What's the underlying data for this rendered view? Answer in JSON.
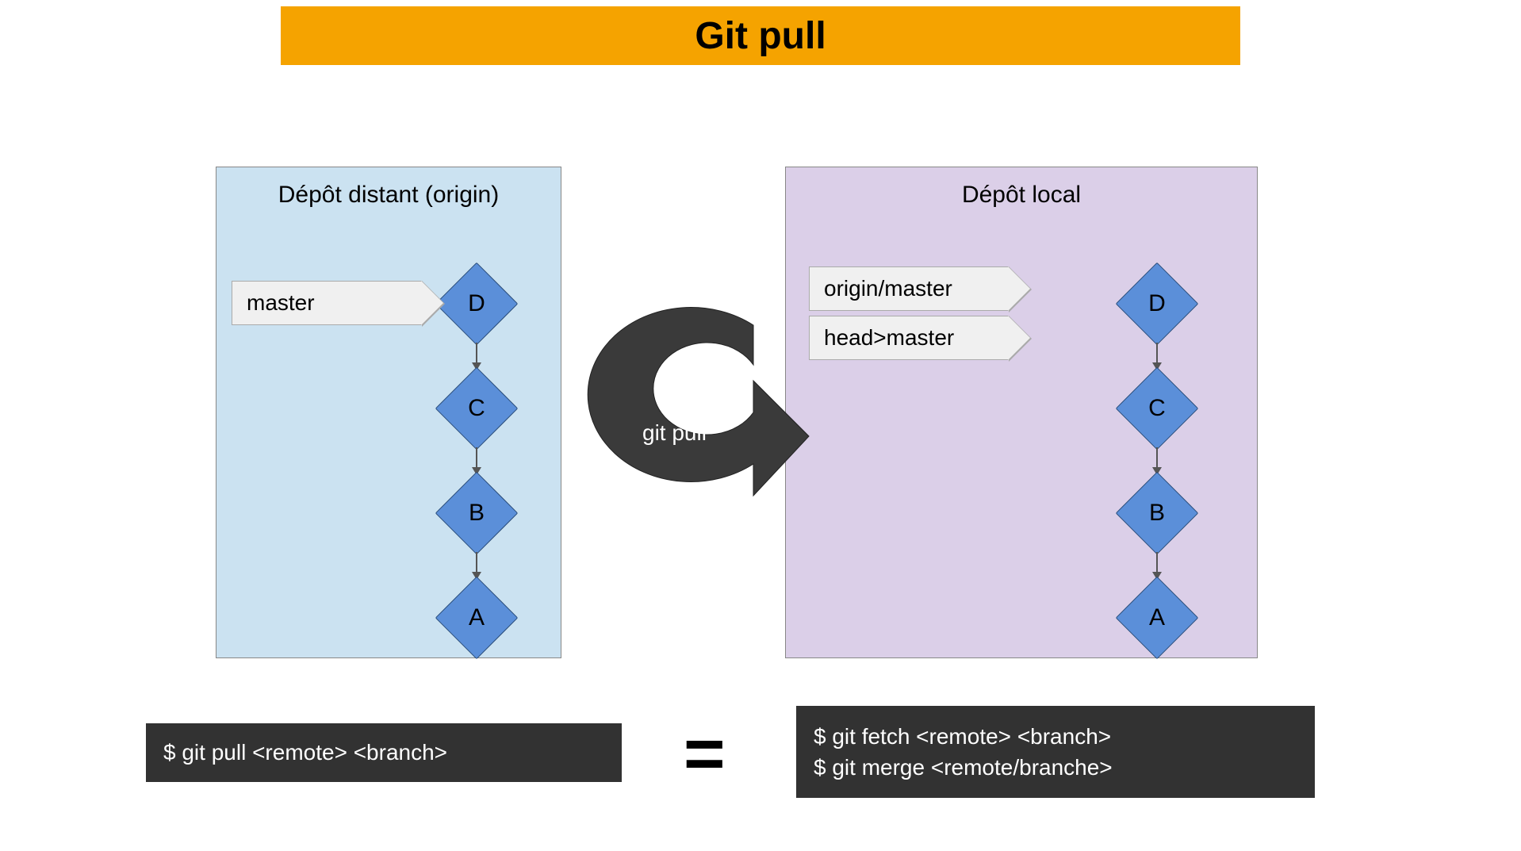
{
  "title": "Git pull",
  "remote": {
    "title": "Dépôt distant (origin)",
    "branch_label": "master",
    "commits": {
      "d": "D",
      "c": "C",
      "b": "B",
      "a": "A"
    }
  },
  "local": {
    "title": "Dépôt local",
    "labels": {
      "tracking": "origin/master",
      "head": "head>master"
    },
    "commits": {
      "d": "D",
      "c": "C",
      "b": "B",
      "a": "A"
    }
  },
  "arrow_label": "git pull",
  "equals": "=",
  "cmd": {
    "pull": "$ git pull <remote> <branch>",
    "fetch": "$ git fetch <remote> <branch>",
    "merge": "$ git merge <remote/branche>"
  }
}
